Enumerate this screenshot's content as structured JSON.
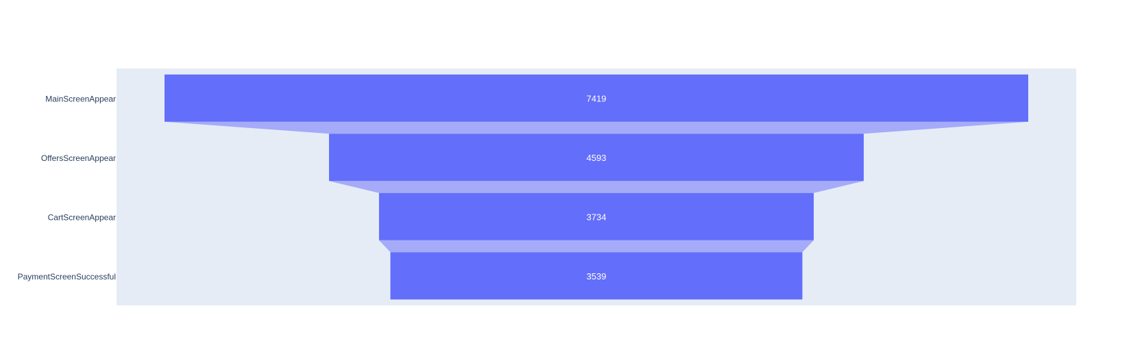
{
  "chart_data": {
    "type": "funnel",
    "title": "",
    "xlabel": "",
    "ylabel": "",
    "categories": [
      "MainScreenAppear",
      "OffersScreenAppear",
      "CartScreenAppear",
      "PaymentScreenSuccessful"
    ],
    "values": [
      7419,
      4593,
      3734,
      3539
    ],
    "grid": false,
    "legend": "none"
  },
  "colors": {
    "page_background": "#ffffff",
    "plot_background": "#e5ecf6",
    "bar_fill": "#636efa",
    "connector_fill": "#a5abf8",
    "label_text": "#ffffff",
    "tick_text": "#2a3f5f"
  }
}
